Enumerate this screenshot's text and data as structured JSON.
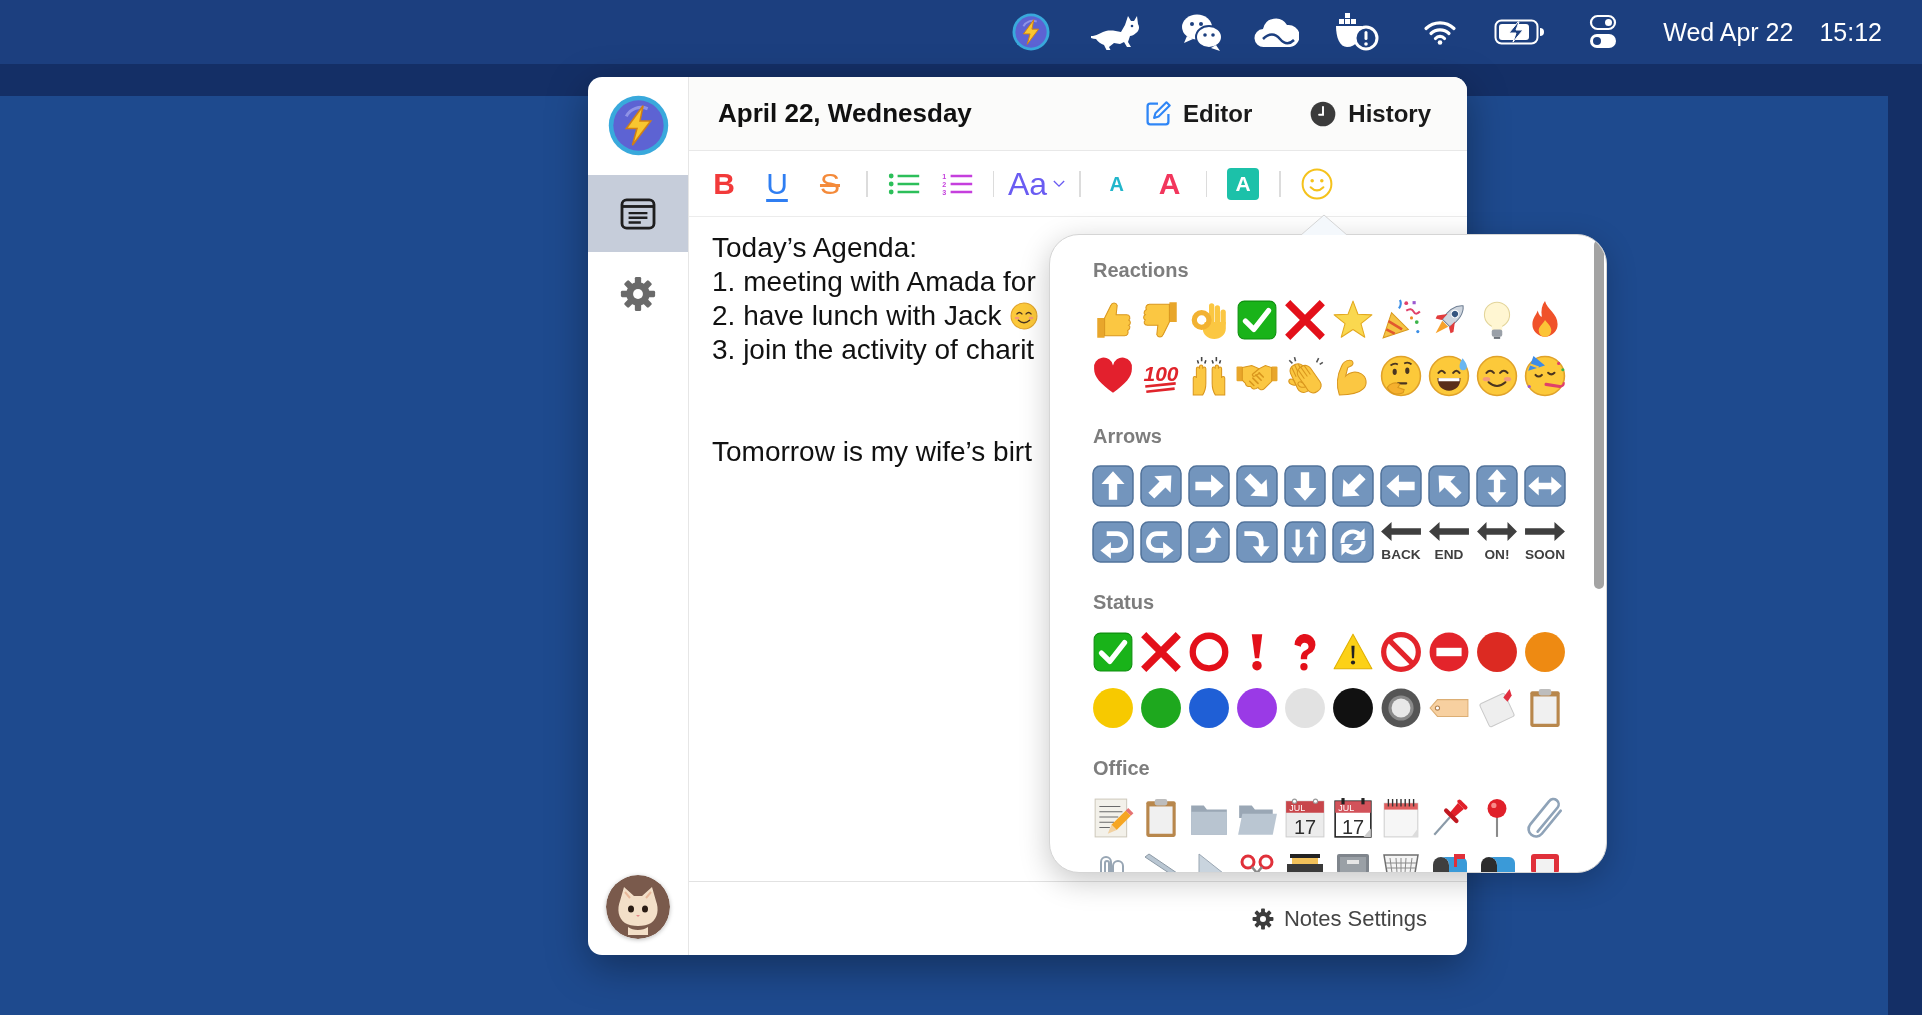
{
  "menu_bar": {
    "date": "Wed Apr 22",
    "time": "15:12"
  },
  "sidebar": {
    "items": [
      {
        "kind": "notes",
        "selected": true
      },
      {
        "kind": "settings",
        "selected": false
      }
    ]
  },
  "header": {
    "title": "April 22, Wednesday",
    "buttons": [
      {
        "kind": "editor",
        "label": "Editor"
      },
      {
        "kind": "history",
        "label": "History"
      }
    ]
  },
  "toolbar": {
    "groups": [
      {
        "items": [
          {
            "kind": "bold",
            "label": "B"
          },
          {
            "kind": "underline",
            "label": "U"
          },
          {
            "kind": "strikethrough",
            "label": "S"
          }
        ]
      },
      {
        "items": [
          {
            "kind": "bullet-list"
          },
          {
            "kind": "numbered-list",
            "markers": [
              "1",
              "2",
              "3"
            ]
          }
        ]
      },
      {
        "items": [
          {
            "kind": "font-size",
            "label": "Aa"
          }
        ]
      },
      {
        "items": [
          {
            "kind": "smaller",
            "label": "A"
          },
          {
            "kind": "larger",
            "label": "A"
          }
        ]
      },
      {
        "items": [
          {
            "kind": "highlight",
            "label": "A"
          }
        ]
      },
      {
        "items": [
          {
            "kind": "emoji"
          }
        ]
      }
    ]
  },
  "editor": {
    "paragraphs": [
      {
        "lines": [
          {
            "kind": "plain",
            "text": "Today’s Agenda:"
          },
          {
            "kind": "plain",
            "text": "1. meeting with Amada for"
          },
          {
            "kind": "with-emoji",
            "text": "2. have lunch with Jack"
          },
          {
            "kind": "plain",
            "text": "3. join the activity of charit"
          }
        ]
      },
      {
        "lines": [
          {
            "kind": "plain",
            "text": "Tomorrow is my wife’s birt"
          }
        ]
      }
    ]
  },
  "footer": {
    "button": "Notes Settings"
  },
  "emoji_picker": {
    "sections": [
      {
        "title": "Reactions",
        "items": [
          {
            "kind": "thumbs-up"
          },
          {
            "kind": "thumbs-down"
          },
          {
            "kind": "ok-hand"
          },
          {
            "kind": "check-box"
          },
          {
            "kind": "cross"
          },
          {
            "kind": "star"
          },
          {
            "kind": "party-popper"
          },
          {
            "kind": "rocket"
          },
          {
            "kind": "light-bulb"
          },
          {
            "kind": "fire"
          },
          {
            "kind": "heart"
          },
          {
            "kind": "hundred",
            "text": "100"
          },
          {
            "kind": "raised-hands"
          },
          {
            "kind": "handshake"
          },
          {
            "kind": "clapping-hands"
          },
          {
            "kind": "biceps"
          },
          {
            "kind": "thinking-face"
          },
          {
            "kind": "sweat-smile-face"
          },
          {
            "kind": "smiling-face"
          },
          {
            "kind": "party-face"
          }
        ]
      },
      {
        "title": "Arrows",
        "items": [
          {
            "kind": "arrow-up"
          },
          {
            "kind": "arrow-up-right"
          },
          {
            "kind": "arrow-right"
          },
          {
            "kind": "arrow-down-right"
          },
          {
            "kind": "arrow-down"
          },
          {
            "kind": "arrow-down-left"
          },
          {
            "kind": "arrow-left"
          },
          {
            "kind": "arrow-up-left"
          },
          {
            "kind": "arrow-up-down"
          },
          {
            "kind": "arrow-left-right"
          },
          {
            "kind": "hook-left"
          },
          {
            "kind": "hook-right"
          },
          {
            "kind": "curve-up"
          },
          {
            "kind": "curve-down"
          },
          {
            "kind": "arrows-clockwise"
          },
          {
            "kind": "arrows-cycle"
          },
          {
            "kind": "word-left",
            "text": "BACK"
          },
          {
            "kind": "word-left",
            "text": "END"
          },
          {
            "kind": "word-both",
            "text": "ON!"
          },
          {
            "kind": "word-right",
            "text": "SOON"
          }
        ]
      },
      {
        "title": "Status",
        "items": [
          {
            "kind": "check-box"
          },
          {
            "kind": "cross"
          },
          {
            "kind": "ring"
          },
          {
            "kind": "exclamation"
          },
          {
            "kind": "question"
          },
          {
            "kind": "warning"
          },
          {
            "kind": "prohibited"
          },
          {
            "kind": "no-entry"
          },
          {
            "kind": "circle",
            "color": "#dc2a22"
          },
          {
            "kind": "circle",
            "color": "#ee8a12"
          },
          {
            "kind": "circle",
            "color": "#f7c900"
          },
          {
            "kind": "circle",
            "color": "#1ea81e"
          },
          {
            "kind": "circle",
            "color": "#1f5fd6"
          },
          {
            "kind": "circle",
            "color": "#9a3ae6"
          },
          {
            "kind": "circle",
            "color": "#e2e2e2"
          },
          {
            "kind": "circle",
            "color": "#111111"
          },
          {
            "kind": "radio-button"
          },
          {
            "kind": "tag"
          },
          {
            "kind": "ribbon-card"
          },
          {
            "kind": "clipboard"
          }
        ]
      },
      {
        "title": "Office",
        "items": [
          {
            "kind": "memo"
          },
          {
            "kind": "clipboard"
          },
          {
            "kind": "folder"
          },
          {
            "kind": "open-folder"
          },
          {
            "kind": "calendar",
            "month": "JUL",
            "day": "17"
          },
          {
            "kind": "tear-off-calendar",
            "month": "JUL",
            "day": "17"
          },
          {
            "kind": "spiral-notepad"
          },
          {
            "kind": "pushpin"
          },
          {
            "kind": "round-pushpin"
          },
          {
            "kind": "paperclip"
          },
          {
            "kind": "linked-paperclips"
          },
          {
            "kind": "ruler"
          },
          {
            "kind": "triangle-ruler"
          },
          {
            "kind": "scissors"
          },
          {
            "kind": "card-box"
          },
          {
            "kind": "file-cabinet"
          },
          {
            "kind": "wastebasket"
          },
          {
            "kind": "mailbox-flag"
          },
          {
            "kind": "mailbox"
          },
          {
            "kind": "postbox"
          }
        ]
      }
    ]
  }
}
